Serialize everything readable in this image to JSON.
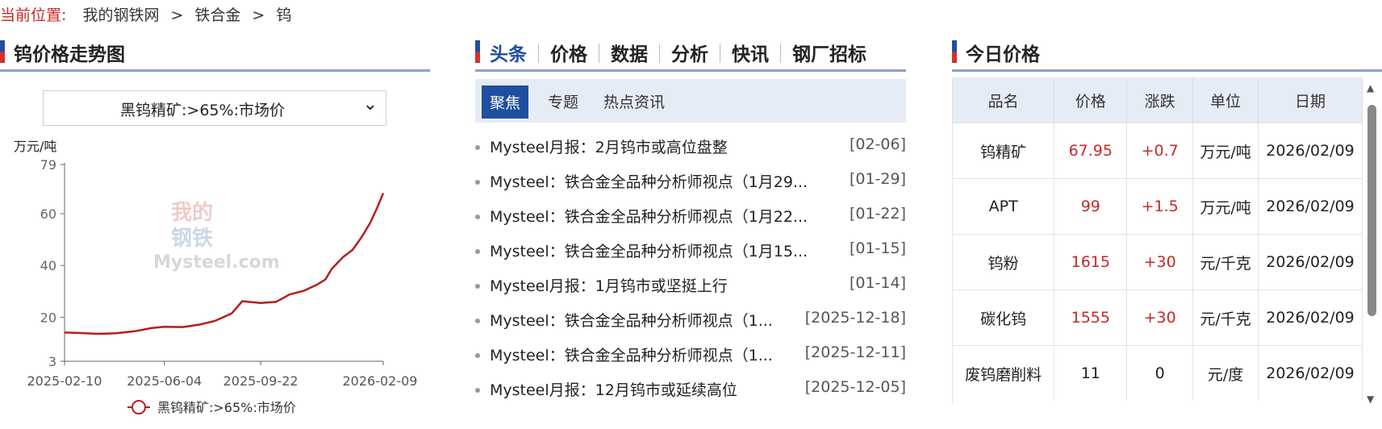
{
  "breadcrumb": {
    "lead": "当前位置:",
    "items": [
      "我的钢铁网",
      "铁合金",
      "钨"
    ],
    "sep": ">"
  },
  "left": {
    "title": "钨价格走势图",
    "select_value": "黑钨精矿:>65%:市场价",
    "unit": "万元/吨",
    "watermark": {
      "line1": "我的",
      "line2": "钢铁",
      "brand": "Mysteel.com"
    }
  },
  "chart_data": {
    "type": "line",
    "yunit": "万元/吨",
    "ylim": [
      3,
      79
    ],
    "yticks": [
      3,
      20,
      40,
      60,
      79
    ],
    "xticks": [
      "2025-02-10",
      "2025-06-04",
      "2025-09-22",
      "2026-02-09"
    ],
    "series": [
      {
        "name": "黑钨精矿:>65%:市场价",
        "color": "#b71c1c",
        "points": [
          [
            "2025-02-10",
            14.1
          ],
          [
            "2025-03-01",
            13.9
          ],
          [
            "2025-03-20",
            13.6
          ],
          [
            "2025-04-10",
            13.8
          ],
          [
            "2025-05-01",
            14.6
          ],
          [
            "2025-05-20",
            15.8
          ],
          [
            "2025-06-04",
            16.3
          ],
          [
            "2025-06-25",
            16.2
          ],
          [
            "2025-07-15",
            17.2
          ],
          [
            "2025-08-01",
            18.6
          ],
          [
            "2025-08-20",
            21.5
          ],
          [
            "2025-09-01",
            26.2
          ],
          [
            "2025-09-22",
            25.5
          ],
          [
            "2025-10-10",
            26.0
          ],
          [
            "2025-10-25",
            28.8
          ],
          [
            "2025-11-10",
            30.2
          ],
          [
            "2025-11-25",
            32.5
          ],
          [
            "2025-12-05",
            34.6
          ],
          [
            "2025-12-12",
            38.6
          ],
          [
            "2025-12-25",
            43.2
          ],
          [
            "2026-01-05",
            46.0
          ],
          [
            "2026-01-15",
            50.8
          ],
          [
            "2026-01-25",
            56.4
          ],
          [
            "2026-02-02",
            62.2
          ],
          [
            "2026-02-09",
            67.95
          ]
        ]
      }
    ]
  },
  "middle": {
    "tabs": [
      "头条",
      "价格",
      "数据",
      "分析",
      "快讯",
      "钢厂招标"
    ],
    "subtabs": [
      "聚焦",
      "专题",
      "热点资讯"
    ],
    "news": [
      {
        "title": "Mysteel月报：2月钨市或高位盘整",
        "date": "[02-06]"
      },
      {
        "title": "Mysteel：铁合金全品种分析师视点（1月29...",
        "date": "[01-29]"
      },
      {
        "title": "Mysteel：铁合金全品种分析师视点（1月22...",
        "date": "[01-22]"
      },
      {
        "title": "Mysteel：铁合金全品种分析师视点（1月15...",
        "date": "[01-15]"
      },
      {
        "title": "Mysteel月报：1月钨市或坚挺上行",
        "date": "[01-14]"
      },
      {
        "title": "Mysteel：铁合金全品种分析师视点（1...",
        "date": "[2025-12-18]"
      },
      {
        "title": "Mysteel：铁合金全品种分析师视点（1...",
        "date": "[2025-12-11]"
      },
      {
        "title": "Mysteel月报：12月钨市或延续高位",
        "date": "[2025-12-05]"
      }
    ]
  },
  "right": {
    "title": "今日价格",
    "headers": [
      "品名",
      "价格",
      "涨跌",
      "单位",
      "日期"
    ],
    "rows": [
      [
        "钨精矿",
        "67.95",
        "+0.7",
        "万元/吨",
        "2026/02/09"
      ],
      [
        "APT",
        "99",
        "+1.5",
        "万元/吨",
        "2026/02/09"
      ],
      [
        "钨粉",
        "1615",
        "+30",
        "元/千克",
        "2026/02/09"
      ],
      [
        "碳化钨",
        "1555",
        "+30",
        "元/千克",
        "2026/02/09"
      ],
      [
        "废钨磨削料",
        "11",
        "0",
        "元/度",
        "2026/02/09"
      ]
    ]
  }
}
